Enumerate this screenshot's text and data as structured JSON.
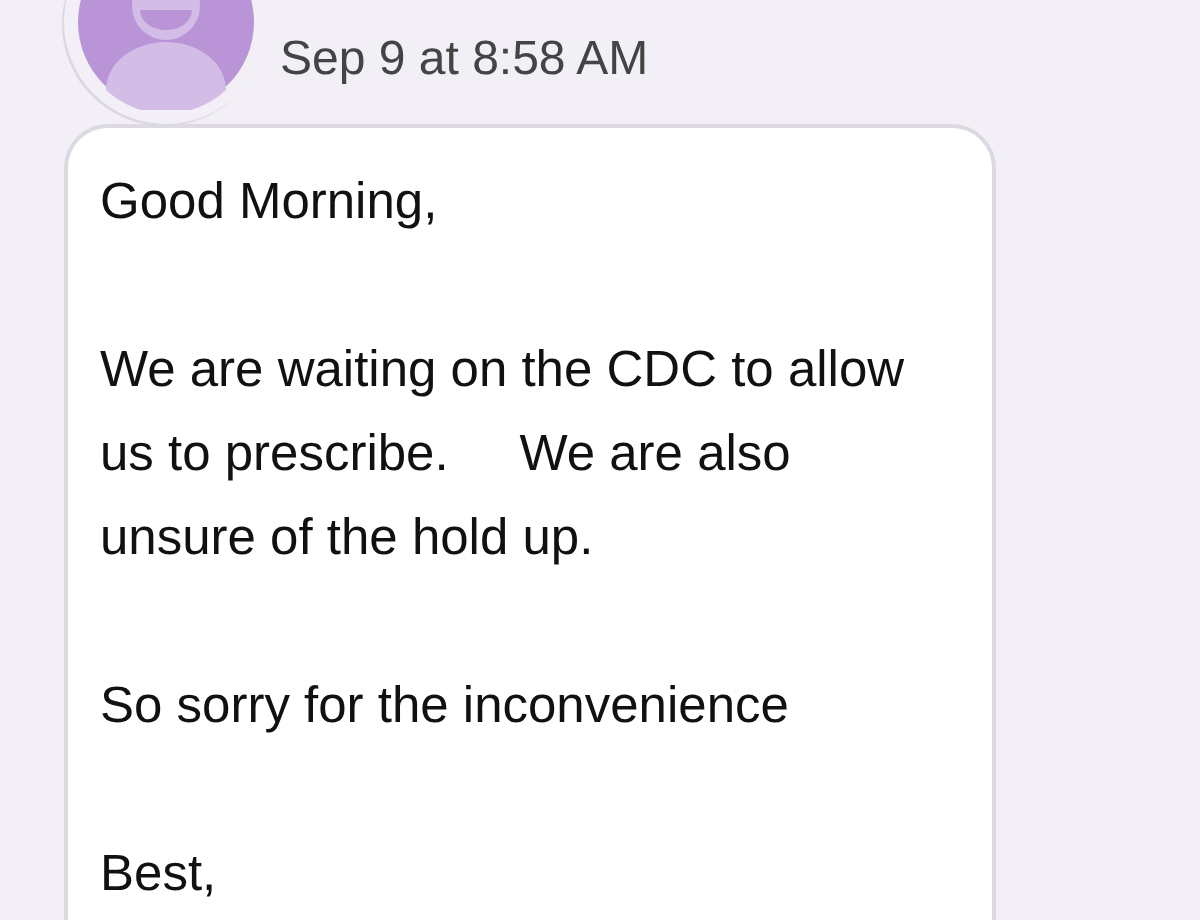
{
  "message": {
    "timestamp": "Sep 9 at 8:58 AM",
    "paragraphs": [
      "Good Morning,",
      "We are waiting on the CDC to allow us to prescribe.     We are also unsure of the hold up.",
      "So sorry for the inconvenience",
      "Best,"
    ]
  }
}
